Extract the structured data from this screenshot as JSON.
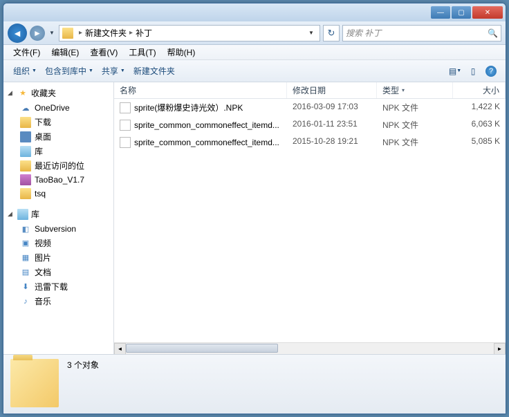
{
  "titlebar": {
    "min": "—",
    "max": "▢",
    "close": "✕"
  },
  "nav": {
    "crumb1": "新建文件夹",
    "crumb2": "补丁",
    "search_placeholder": "搜索 补丁"
  },
  "menu": {
    "file": "文件(F)",
    "edit": "编辑(E)",
    "view": "查看(V)",
    "tools": "工具(T)",
    "help": "帮助(H)"
  },
  "toolbar": {
    "organize": "组织",
    "include": "包含到库中",
    "share": "共享",
    "newfolder": "新建文件夹"
  },
  "sidebar": {
    "fav_hdr": "收藏夹",
    "fav": [
      "OneDrive",
      "下载",
      "桌面",
      "库",
      "最近访问的位",
      "TaoBao_V1.7",
      "tsq"
    ],
    "lib_hdr": "库",
    "lib": [
      "Subversion",
      "视频",
      "图片",
      "文档",
      "迅雷下载",
      "音乐"
    ]
  },
  "columns": {
    "name": "名称",
    "date": "修改日期",
    "type": "类型",
    "size": "大小"
  },
  "files": [
    {
      "name": "sprite(爆粉爆史诗光效）.NPK",
      "date": "2016-03-09 17:03",
      "type": "NPK 文件",
      "size": "1,422 K"
    },
    {
      "name": "sprite_common_commoneffect_itemd...",
      "date": "2016-01-11 23:51",
      "type": "NPK 文件",
      "size": "6,063 K"
    },
    {
      "name": "sprite_common_commoneffect_itemd...",
      "date": "2015-10-28 19:21",
      "type": "NPK 文件",
      "size": "5,085 K"
    }
  ],
  "status": {
    "text": "3 个对象"
  }
}
